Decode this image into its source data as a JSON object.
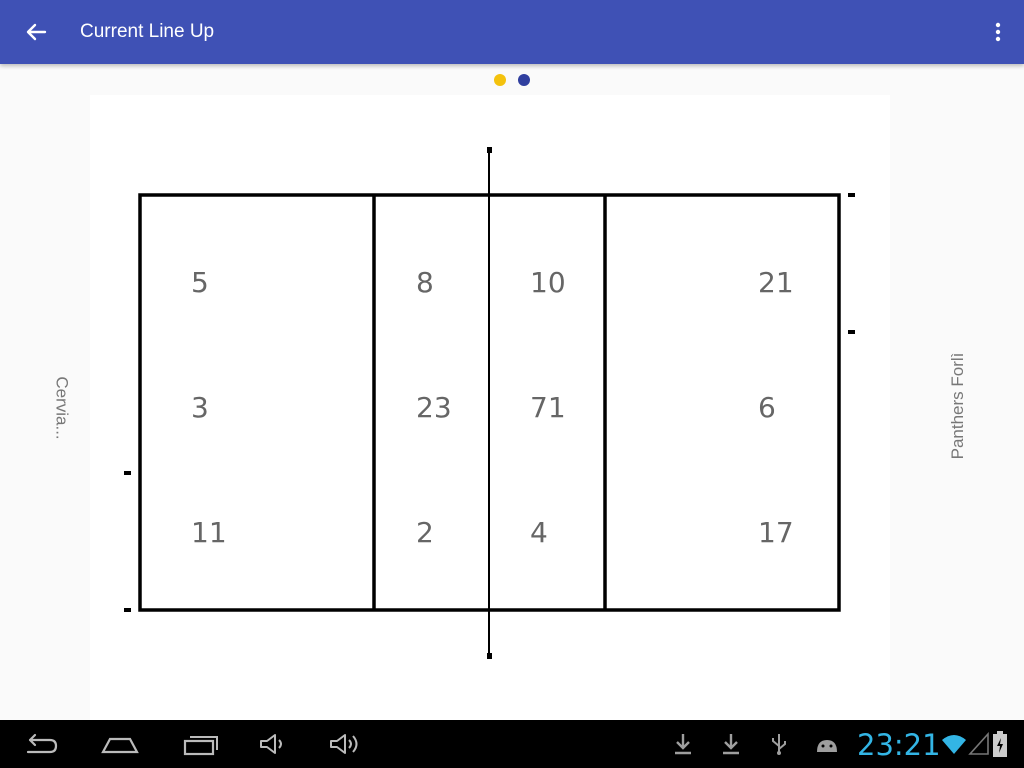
{
  "appbar": {
    "title": "Current Line Up",
    "back_icon": "arrow-back-icon",
    "menu_icon": "more-vert-icon",
    "color": "#3f51b5"
  },
  "pager": {
    "dots": [
      {
        "color": "#f4c20d",
        "active": true
      },
      {
        "color": "#303f9f",
        "active": false
      }
    ]
  },
  "court": {
    "left_team": "Cervia...",
    "right_team": "Panthers Forlì",
    "left_back_zone": [
      "5",
      "3",
      "11"
    ],
    "left_front_zone": [
      "8",
      "23",
      "2"
    ],
    "right_front_zone": [
      "10",
      "71",
      "4"
    ],
    "right_back_zone": [
      "21",
      "6",
      "17"
    ]
  },
  "statusbar": {
    "time": "23:21",
    "icons": [
      "download-icon",
      "download-icon",
      "usb-icon",
      "android-debug-icon",
      "wifi-icon",
      "signal-icon",
      "battery-charging-icon"
    ],
    "nav_icons": [
      "back-nav-icon",
      "home-nav-icon",
      "recents-nav-icon",
      "volume-down-icon",
      "volume-up-icon"
    ],
    "time_color": "#33b5e5"
  }
}
